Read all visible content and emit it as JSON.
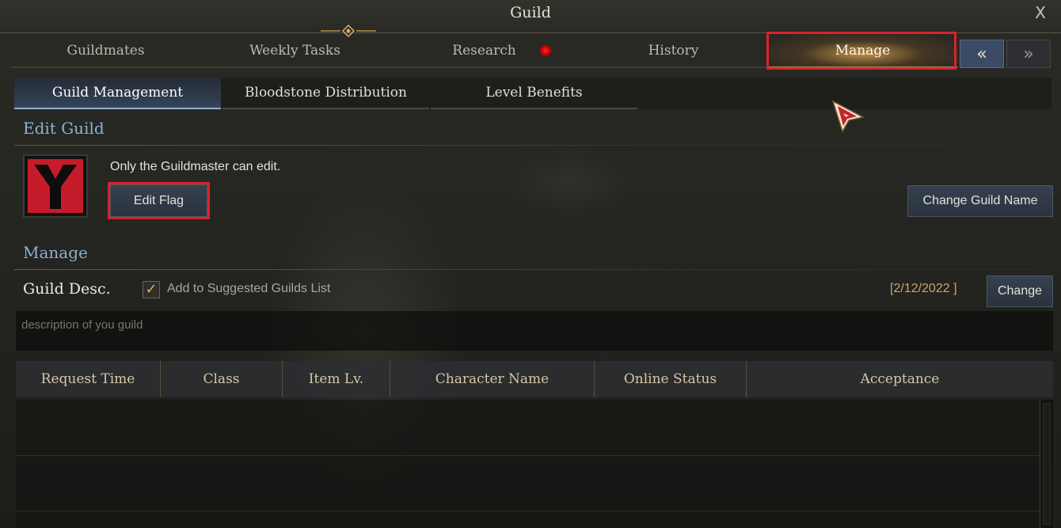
{
  "window": {
    "title": "Guild",
    "close_label": "X"
  },
  "main_tabs": [
    {
      "label": "Guildmates",
      "active": false
    },
    {
      "label": "Weekly Tasks",
      "active": false
    },
    {
      "label": "Research",
      "active": false,
      "notification": true
    },
    {
      "label": "History",
      "active": false
    },
    {
      "label": "Manage",
      "active": true
    }
  ],
  "nav": {
    "prev_label": "«",
    "next_label": "»"
  },
  "sub_tabs": [
    {
      "label": "Guild Management",
      "active": true
    },
    {
      "label": "Bloodstone Distribution",
      "active": false
    },
    {
      "label": "Level Benefits",
      "active": false
    }
  ],
  "edit_guild": {
    "heading": "Edit Guild",
    "notice": "Only the Guildmaster can edit.",
    "edit_flag_label": "Edit Flag",
    "change_name_label": "Change Guild Name",
    "flag_colors": {
      "field": "#c61b2a",
      "emblem": "#0d0d0d"
    }
  },
  "manage": {
    "heading": "Manage",
    "guild_desc_label": "Guild Desc.",
    "suggested_checked": true,
    "suggested_label": "Add to Suggested Guilds List",
    "date": "[2/12/2022 ]",
    "change_label": "Change",
    "description_placeholder": "description of you guild"
  },
  "table": {
    "columns": [
      "Request Time",
      "Class",
      "Item Lv.",
      "Character Name",
      "Online Status",
      "Acceptance"
    ],
    "rows": []
  },
  "colors": {
    "highlight_box": "#d9232b",
    "section_heading": "#8fb0d4",
    "active_tab_glow": "#ebb45a"
  }
}
